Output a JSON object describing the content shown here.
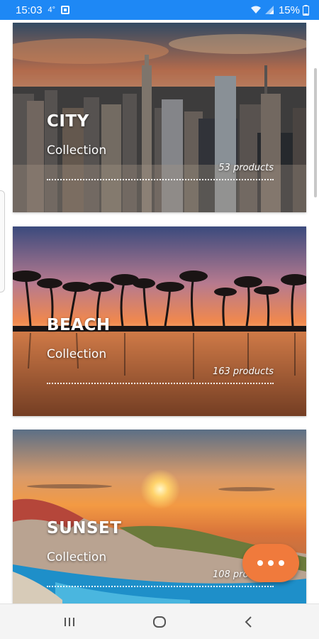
{
  "status_bar": {
    "time": "15:03",
    "notification": "4°",
    "battery": "15%",
    "background": "#1e88f5",
    "icons": [
      "app-icon",
      "wifi-icon",
      "signal-icon",
      "battery-icon"
    ]
  },
  "collections": [
    {
      "title": "CITY",
      "subtitle": "Collection",
      "count": "53 products",
      "image": "city-skyline"
    },
    {
      "title": "BEACH",
      "subtitle": "Collection",
      "count": "163 products",
      "image": "palm-beach-sunset"
    },
    {
      "title": "SUNSET",
      "subtitle": "Collection",
      "count": "108 products",
      "image": "coastal-sunset"
    }
  ],
  "fab": {
    "icon": "more-horiz-icon",
    "color": "#f07a3c"
  },
  "nav_bar": {
    "icons": [
      "recent-apps-icon",
      "home-icon",
      "back-icon"
    ]
  }
}
